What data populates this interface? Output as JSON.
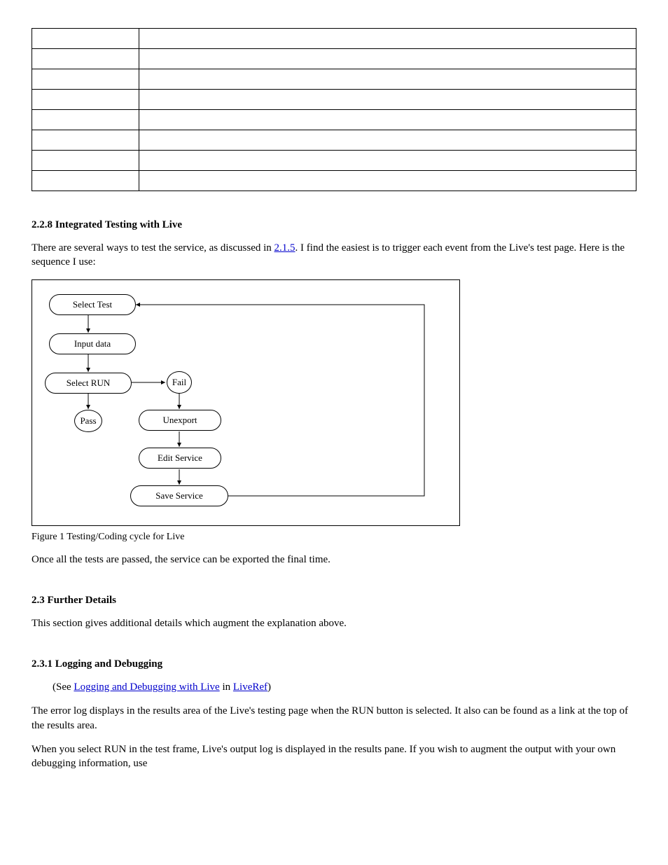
{
  "table_rows": [
    {
      "c1": "",
      "c2": ""
    },
    {
      "c1": "",
      "c2": ""
    },
    {
      "c1": "",
      "c2": ""
    },
    {
      "c1": "",
      "c2": ""
    },
    {
      "c1": "",
      "c2": ""
    },
    {
      "c1": "",
      "c2": ""
    },
    {
      "c1": "",
      "c2": ""
    },
    {
      "c1": "",
      "c2": ""
    }
  ],
  "heading_testing": "2.2.8 Integrated Testing with Live",
  "p_testing_1_a": "There are several ways to test the service, as discussed in ",
  "p_testing_1_link": "2.1.5",
  "p_testing_1_b": ".  I find the easiest is to trigger each event from the Live's test page.  Here is the sequence I use:",
  "flow": {
    "select_test": "Select Test",
    "input_data": "Input data",
    "select_run": "Select  RUN",
    "pass": "Pass",
    "fail": "Fail",
    "unexport": "Unexport",
    "edit_service": "Edit  Service",
    "save_service": "Save  Service"
  },
  "fig_caption": "Figure 1 Testing/Coding cycle for Live",
  "p_after_fig": "Once all the tests are passed, the service can be exported the final time.",
  "heading_further": "2.3 Further Details",
  "p_further_1": "This section gives additional details which augment the explanation above.",
  "heading_logging": "2.3.1 Logging and Debugging",
  "p_logging_1_a": "(See ",
  "p_logging_1_link1": "Logging and Debugging with Live",
  "p_logging_1_b": " in ",
  "p_logging_1_link2": "LiveRef",
  "p_logging_1_c": ")",
  "p_logging_2": "The error log displays in the results area of the Live's testing page when the RUN button is selected.  It also can be found as a link at the top of the results area.",
  "p_logging_3": "When you select RUN in the test frame, Live's output log is displayed in the results pane.  If you wish to augment the output with your own debugging information, use"
}
